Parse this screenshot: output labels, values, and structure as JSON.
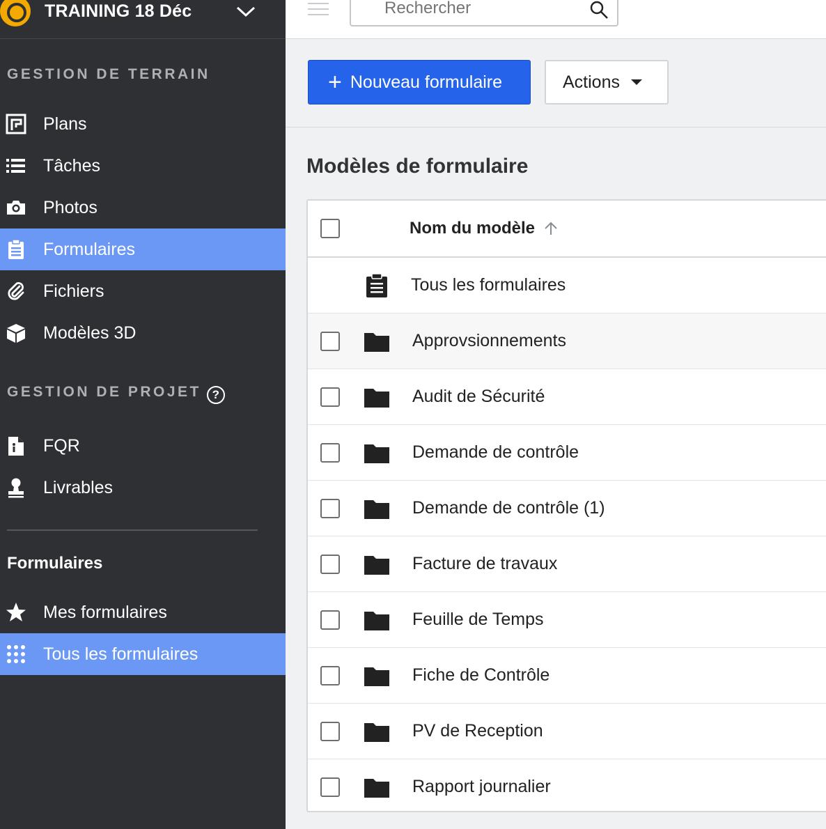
{
  "project": {
    "name": "TRAINING 18 Déc"
  },
  "sidebar": {
    "terrain_title": "GESTION DE TERRAIN",
    "terrain_items": [
      {
        "label": "Plans",
        "icon": "plans-icon"
      },
      {
        "label": "Tâches",
        "icon": "list-icon"
      },
      {
        "label": "Photos",
        "icon": "camera-icon"
      },
      {
        "label": "Formulaires",
        "icon": "clipboard-icon",
        "active": true
      },
      {
        "label": "Fichiers",
        "icon": "paperclip-icon"
      },
      {
        "label": "Modèles 3D",
        "icon": "cube-icon"
      }
    ],
    "projet_title": "GESTION DE PROJET",
    "projet_items": [
      {
        "label": "FQR",
        "icon": "document-info-icon"
      },
      {
        "label": "Livrables",
        "icon": "stamp-icon"
      }
    ],
    "forms_title": "Formulaires",
    "forms_items": [
      {
        "label": "Mes formulaires",
        "icon": "star-icon"
      },
      {
        "label": "Tous les formulaires",
        "icon": "grid-dots-icon",
        "active": true
      }
    ]
  },
  "search": {
    "placeholder": "Rechercher"
  },
  "toolbar": {
    "new_label": "Nouveau formulaire",
    "actions_label": "Actions"
  },
  "main": {
    "title": "Modèles de formulaire",
    "column_header": "Nom du modèle",
    "all_forms_label": "Tous les formulaires",
    "folders": [
      "Approvsionnements",
      "Audit de Sécurité",
      "Demande de contrôle",
      "Demande de contrôle (1)",
      "Facture de travaux",
      "Feuille de Temps",
      "Fiche de Contrôle",
      "PV de Reception",
      "Rapport journalier"
    ]
  },
  "colors": {
    "sidebar_bg": "#2f3033",
    "active_bg": "#6b98f4",
    "primary": "#2563eb",
    "logo": "#f2a900"
  }
}
